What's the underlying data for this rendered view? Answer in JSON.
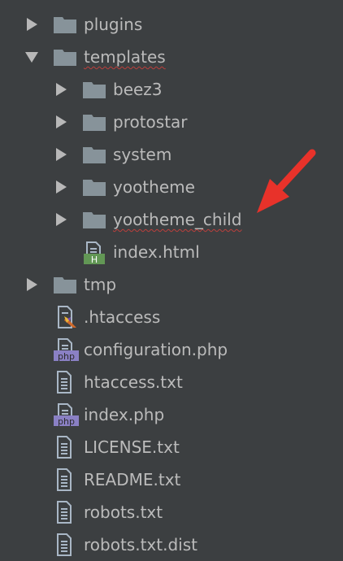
{
  "tree": {
    "items": [
      {
        "label": "plugins",
        "type": "folder",
        "icon": "folder-icon",
        "state": "collapsed"
      },
      {
        "label": "templates",
        "type": "folder",
        "icon": "folder-icon",
        "state": "expanded"
      },
      {
        "label": "beez3",
        "type": "folder",
        "icon": "folder-icon",
        "state": "collapsed"
      },
      {
        "label": "protostar",
        "type": "folder",
        "icon": "folder-icon",
        "state": "collapsed"
      },
      {
        "label": "system",
        "type": "folder",
        "icon": "folder-icon",
        "state": "collapsed"
      },
      {
        "label": "yootheme",
        "type": "folder",
        "icon": "folder-icon",
        "state": "collapsed"
      },
      {
        "label": "yootheme_child",
        "type": "folder",
        "icon": "folder-icon",
        "state": "collapsed"
      },
      {
        "label": "index.html",
        "type": "file",
        "icon": "html-file-icon",
        "badge": "H"
      },
      {
        "label": "tmp",
        "type": "folder",
        "icon": "folder-icon",
        "state": "collapsed"
      },
      {
        "label": ".htaccess",
        "type": "file",
        "icon": "htaccess-file-icon"
      },
      {
        "label": "configuration.php",
        "type": "file",
        "icon": "php-file-icon",
        "badge": "php"
      },
      {
        "label": "htaccess.txt",
        "type": "file",
        "icon": "text-file-icon"
      },
      {
        "label": "index.php",
        "type": "file",
        "icon": "php-file-icon",
        "badge": "php"
      },
      {
        "label": "LICENSE.txt",
        "type": "file",
        "icon": "text-file-icon"
      },
      {
        "label": "README.txt",
        "type": "file",
        "icon": "text-file-icon"
      },
      {
        "label": "robots.txt",
        "type": "file",
        "icon": "text-file-icon"
      },
      {
        "label": "robots.txt.dist",
        "type": "file",
        "icon": "text-file-icon"
      }
    ]
  },
  "colors": {
    "background": "#3c3f41",
    "text": "#bbbbbb",
    "folder": "#87939a",
    "file": "#a9b7c6",
    "html_badge": "#629755",
    "php_badge": "#8a80c4",
    "annotation_arrow": "#e8322a",
    "spelling_underline": "#bc3f3c"
  }
}
